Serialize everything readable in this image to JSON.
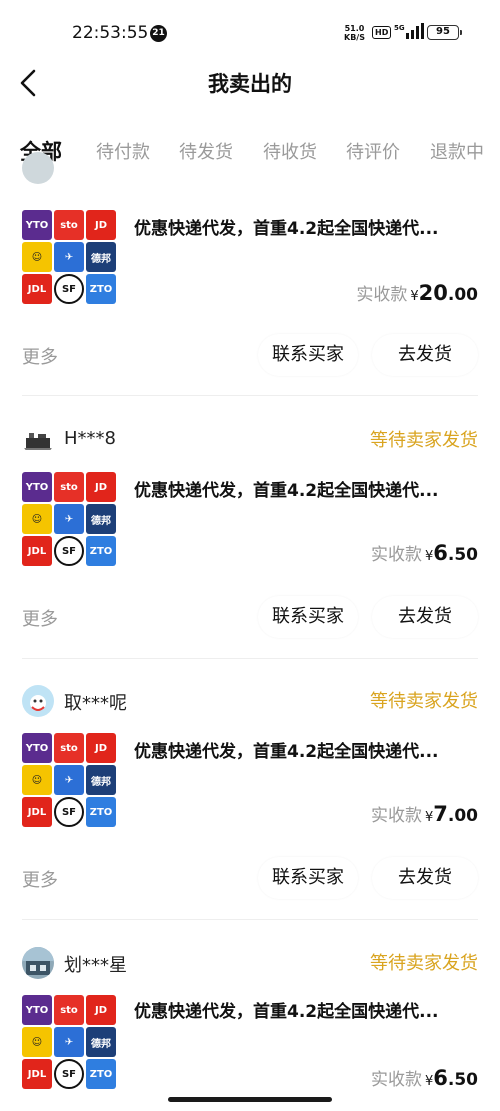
{
  "status_bar": {
    "time": "22:53:55",
    "badge": "21",
    "speed_value": "51.0",
    "speed_unit": "KB/S",
    "hd": "HD",
    "network": "5G",
    "battery": "95"
  },
  "header": {
    "title": "我卖出的"
  },
  "tabs": [
    {
      "label": "全部",
      "active": true
    },
    {
      "label": "待付款"
    },
    {
      "label": "待发货"
    },
    {
      "label": "待收货"
    },
    {
      "label": "待评价"
    },
    {
      "label": "退款中"
    }
  ],
  "colors": {
    "accent": "#ffe60f",
    "status": "#d9a420"
  },
  "orders": [
    {
      "buyer": "",
      "status": "",
      "title": "优惠快递代发，首重4.2起全国快递代...",
      "price_label": "实收款",
      "currency": "¥",
      "price_int": "20",
      "price_dec": ".00",
      "more": "更多",
      "contact": "联系买家",
      "ship": "去发货"
    },
    {
      "buyer": "H***8",
      "status": "等待卖家发货",
      "title": "优惠快递代发，首重4.2起全国快递代...",
      "price_label": "实收款",
      "currency": "¥",
      "price_int": "6",
      "price_dec": ".50",
      "more": "更多",
      "contact": "联系买家",
      "ship": "去发货"
    },
    {
      "buyer": "取***呢",
      "status": "等待卖家发货",
      "title": "优惠快递代发，首重4.2起全国快递代...",
      "price_label": "实收款",
      "currency": "¥",
      "price_int": "7",
      "price_dec": ".00",
      "more": "更多",
      "contact": "联系买家",
      "ship": "去发货"
    },
    {
      "buyer": "划***星",
      "status": "等待卖家发货",
      "title": "优惠快递代发，首重4.2起全国快递代...",
      "price_label": "实收款",
      "currency": "¥",
      "price_int": "6",
      "price_dec": ".50"
    }
  ],
  "thumbnail": {
    "tiles": [
      {
        "text": "YTO",
        "bg": "#5b2c8f",
        "fg": "#ffffff"
      },
      {
        "text": "sto",
        "bg": "#e63027",
        "fg": "#ffffff"
      },
      {
        "text": "JD",
        "bg": "#e1251b",
        "fg": "#ffffff"
      },
      {
        "text": "☺",
        "bg": "#f5c400",
        "fg": "#222222"
      },
      {
        "text": "✈",
        "bg": "#2c6fd6",
        "fg": "#ffffff"
      },
      {
        "text": "德邦",
        "bg": "#1d3f78",
        "fg": "#ffffff"
      },
      {
        "text": "JDL",
        "bg": "#e1251b",
        "fg": "#ffffff"
      },
      {
        "text": "SF",
        "bg": "#ffffff",
        "fg": "#111111"
      },
      {
        "text": "ZTO",
        "bg": "#2f7ee0",
        "fg": "#ffffff"
      }
    ]
  }
}
